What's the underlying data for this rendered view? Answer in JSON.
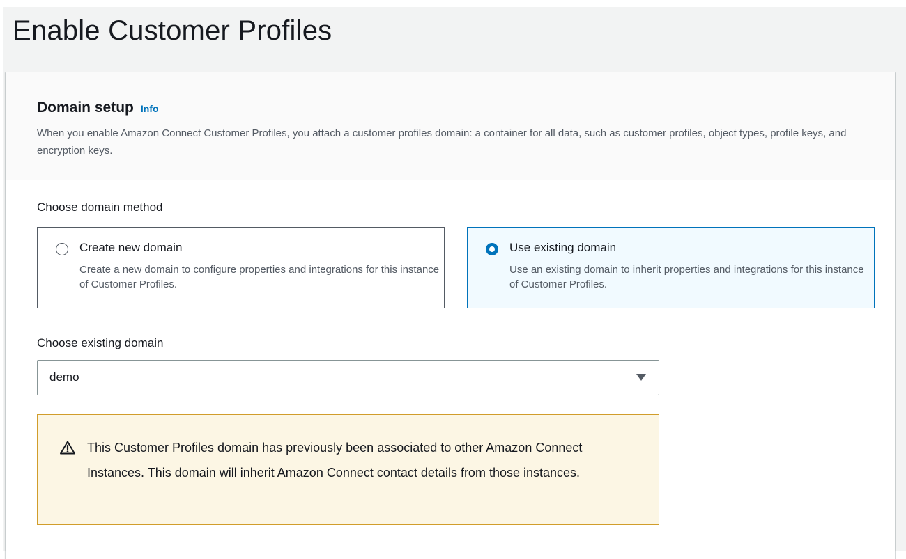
{
  "page": {
    "title": "Enable Customer Profiles"
  },
  "domain_setup": {
    "title": "Domain setup",
    "info_link": "Info",
    "description": "When you enable Amazon Connect Customer Profiles, you attach a customer profiles domain: a container for all data, such as customer profiles, object types, profile keys, and encryption keys."
  },
  "domain_method": {
    "label": "Choose domain method",
    "selected": "use_existing",
    "options": [
      {
        "id": "create_new",
        "label": "Create new domain",
        "description": "Create a new domain to configure properties and integrations for this instance of Customer Profiles."
      },
      {
        "id": "use_existing",
        "label": "Use existing domain",
        "description": "Use an existing domain to inherit properties and integrations for this instance of Customer Profiles."
      }
    ]
  },
  "existing_domain": {
    "label": "Choose existing domain",
    "value": "demo"
  },
  "alert": {
    "icon": "warning-icon",
    "text": "This Customer Profiles domain has previously been associated to other Amazon Connect Instances. This domain will inherit Amazon Connect contact details from those instances."
  },
  "colors": {
    "accent": "#0073bb",
    "warning_border": "#d19d2b",
    "warning_background": "#fcf6e4",
    "selected_tile_background": "#f1faff"
  }
}
